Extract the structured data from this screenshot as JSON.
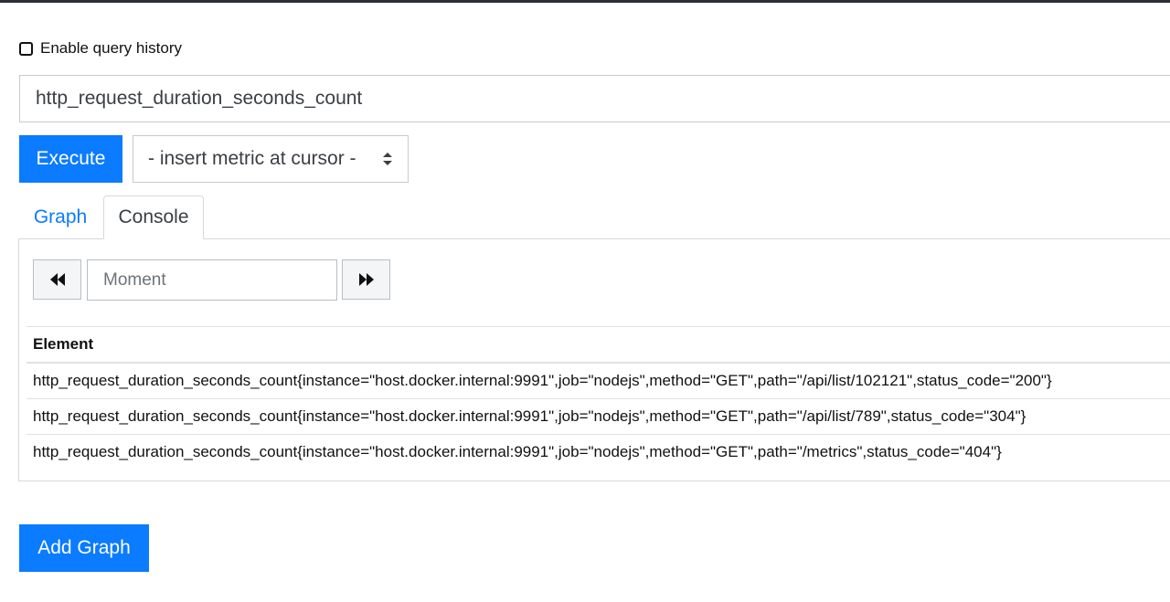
{
  "query_history": {
    "label": "Enable query history",
    "checked": false
  },
  "expression": {
    "value": "http_request_duration_seconds_count"
  },
  "execute": {
    "label": "Execute"
  },
  "metric_select": {
    "selected": "- insert metric at cursor -"
  },
  "tabs": [
    {
      "label": "Graph",
      "active": false
    },
    {
      "label": "Console",
      "active": true
    }
  ],
  "console": {
    "moment_placeholder": "Moment",
    "back_icon": "double-chevron-left-icon",
    "forward_icon": "double-chevron-right-icon",
    "table": {
      "header": "Element",
      "rows": [
        "http_request_duration_seconds_count{instance=\"host.docker.internal:9991\",job=\"nodejs\",method=\"GET\",path=\"/api/list/102121\",status_code=\"200\"}",
        "http_request_duration_seconds_count{instance=\"host.docker.internal:9991\",job=\"nodejs\",method=\"GET\",path=\"/api/list/789\",status_code=\"304\"}",
        "http_request_duration_seconds_count{instance=\"host.docker.internal:9991\",job=\"nodejs\",method=\"GET\",path=\"/metrics\",status_code=\"404\"}"
      ]
    }
  },
  "add_graph": {
    "label": "Add Graph"
  },
  "colors": {
    "primary": "#0b7bff",
    "topbar": "#2b2f33"
  }
}
